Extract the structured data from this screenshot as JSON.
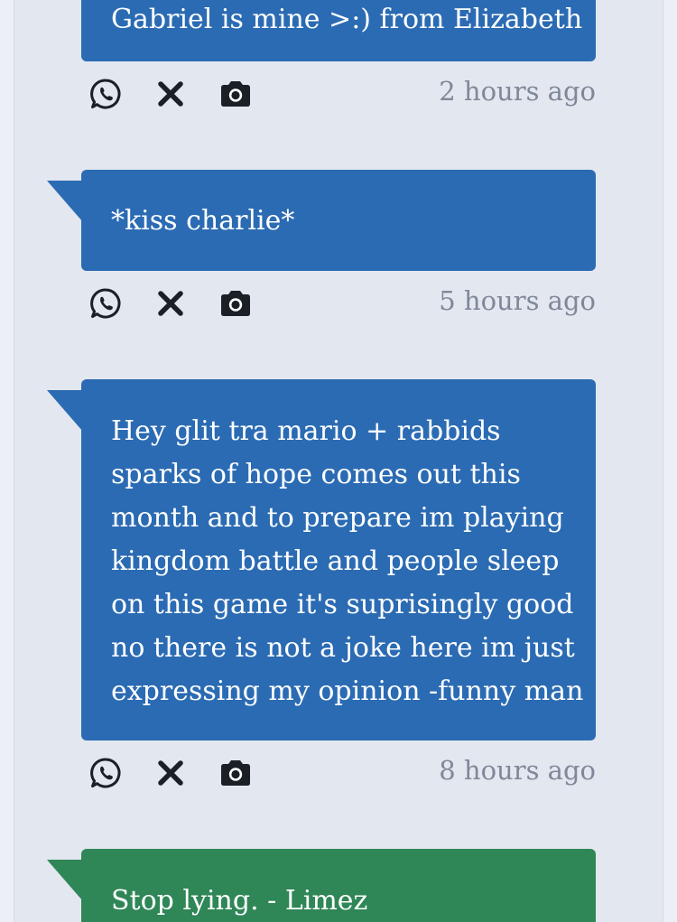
{
  "messages": [
    {
      "text": "Gabriel is mine >:) from Elizabeth",
      "time": "2 hours ago",
      "color": "#2b6bb3"
    },
    {
      "text": "*kiss charlie*",
      "time": "5 hours ago",
      "color": "#2b6bb3"
    },
    {
      "text": "Hey glit tra mario + rabbids sparks of hope comes out this month and to prepare im playing kingdom battle and people sleep on this game it's suprisingly good no there is not a joke here im just expressing my opinion -funny man",
      "time": "8 hours ago",
      "color": "#2b6bb3"
    },
    {
      "text": "Stop lying. - Limez",
      "color": "#2f8657"
    }
  ],
  "icons": [
    "whatsapp-icon",
    "x-icon",
    "camera-icon"
  ]
}
